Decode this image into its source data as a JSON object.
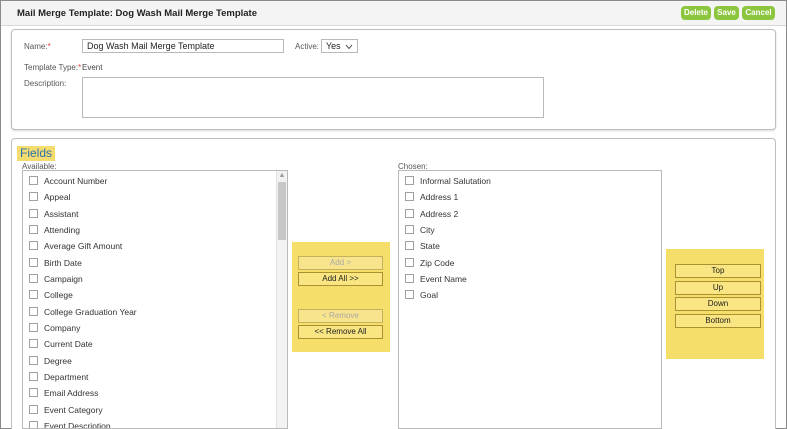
{
  "header": {
    "title": "Mail Merge Template: Dog Wash Mail Merge Template",
    "delete_label": "Delete",
    "save_label": "Save",
    "cancel_label": "Cancel"
  },
  "form": {
    "name_label": "Name:",
    "name_required": "*",
    "name_value": "Dog Wash Mail Merge Template",
    "active_label": "Active:",
    "active_value": "Yes",
    "template_type_label": "Template Type:",
    "template_type_required": "*",
    "template_type_value": "Event",
    "description_label": "Description:",
    "description_value": ""
  },
  "fields": {
    "title": "Fields",
    "available_label": "Available:",
    "chosen_label": "Chosen:",
    "available": [
      "Account Number",
      "Appeal",
      "Assistant",
      "Attending",
      "Average Gift Amount",
      "Birth Date",
      "Campaign",
      "College",
      "College Graduation Year",
      "Company",
      "Current Date",
      "Degree",
      "Department",
      "Email Address",
      "Event Category",
      "Event Description"
    ],
    "chosen": [
      "Informal Salutation",
      "Address 1",
      "Address 2",
      "City",
      "State",
      "Zip Code",
      "Event Name",
      "Goal"
    ],
    "move_buttons": {
      "add": "Add >",
      "add_all": "Add All >>",
      "remove": "< Remove",
      "remove_all": "<< Remove All"
    },
    "order_buttons": {
      "top": "Top",
      "up": "Up",
      "down": "Down",
      "bottom": "Bottom"
    }
  },
  "colors": {
    "button_green": "#8cc63f",
    "highlight_yellow": "#f5df6a",
    "required_red": "#e53935",
    "fields_title_blue": "#2a6fb0"
  }
}
